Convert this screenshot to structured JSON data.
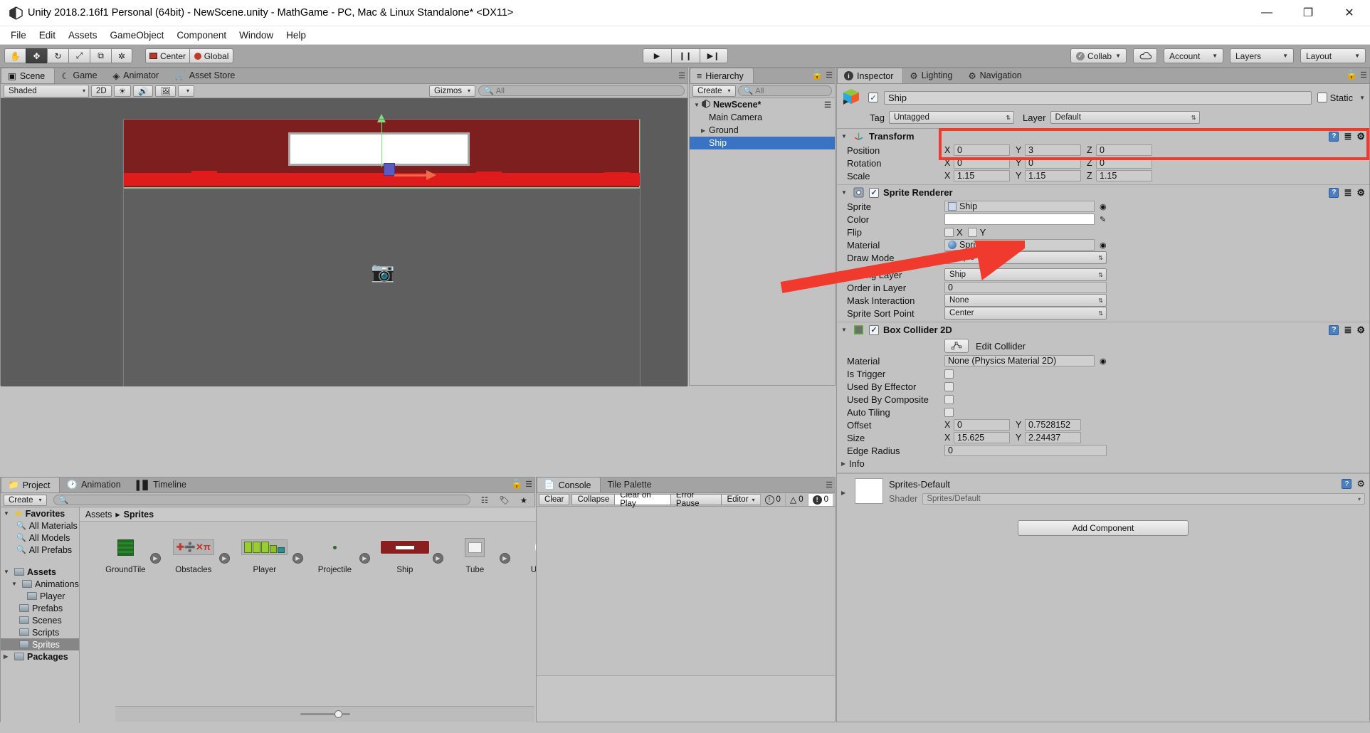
{
  "window": {
    "title": "Unity 2018.2.16f1 Personal (64bit) - NewScene.unity - MathGame - PC, Mac & Linux Standalone* <DX11>",
    "minimize": "—",
    "maximize": "❐",
    "close": "✕"
  },
  "menubar": {
    "items": [
      "File",
      "Edit",
      "Assets",
      "GameObject",
      "Component",
      "Window",
      "Help"
    ]
  },
  "toolbar": {
    "tools": [
      {
        "name": "hand-tool",
        "glyph": "✋"
      },
      {
        "name": "move-tool",
        "glyph": "✥"
      },
      {
        "name": "rotate-tool",
        "glyph": "↻"
      },
      {
        "name": "scale-tool",
        "glyph": "⤢"
      },
      {
        "name": "rect-tool",
        "glyph": "⧉"
      },
      {
        "name": "transform-tool",
        "glyph": "✲"
      }
    ],
    "pivot_label": "Center",
    "space_label": "Global",
    "play": "▶",
    "pause": "❙❙",
    "step": "▶❙",
    "collab": "Collab",
    "cloud": "cloud-icon",
    "account": "Account",
    "layers": "Layers",
    "layout": "Layout"
  },
  "scene": {
    "tabs": [
      {
        "label": "Scene",
        "icon": "grid-icon",
        "active": true
      },
      {
        "label": "Game",
        "icon": "gamepad-icon",
        "active": false
      },
      {
        "label": "Animator",
        "icon": "animator-icon",
        "active": false
      },
      {
        "label": "Asset Store",
        "icon": "store-icon",
        "active": false
      }
    ],
    "draw_mode": "Shaded",
    "mode_2d": "2D",
    "gizmos": "Gizmos",
    "search_placeholder": "All"
  },
  "hierarchy": {
    "tab_label": "Hierarchy",
    "create_label": "Create",
    "search_placeholder": "All",
    "scene_name": "NewScene*",
    "items": [
      {
        "label": "Main Camera",
        "depth": 1,
        "expandable": false,
        "selected": false
      },
      {
        "label": "Ground",
        "depth": 1,
        "expandable": true,
        "selected": false
      },
      {
        "label": "Ship",
        "depth": 1,
        "expandable": false,
        "selected": true
      }
    ]
  },
  "inspector": {
    "tabs": [
      {
        "label": "Inspector",
        "active": true
      },
      {
        "label": "Lighting",
        "active": false
      },
      {
        "label": "Navigation",
        "active": false
      }
    ],
    "object_name": "Ship",
    "enabled": true,
    "static_label": "Static",
    "tag_label": "Tag",
    "tag_value": "Untagged",
    "layer_label": "Layer",
    "layer_value": "Default",
    "transform": {
      "title": "Transform",
      "position": {
        "label": "Position",
        "x": "0",
        "y": "3",
        "z": "0"
      },
      "rotation": {
        "label": "Rotation",
        "x": "0",
        "y": "0",
        "z": "0"
      },
      "scale": {
        "label": "Scale",
        "x": "1.15",
        "y": "1.15",
        "z": "1.15"
      }
    },
    "sprite_renderer": {
      "title": "Sprite Renderer",
      "enabled": true,
      "sprite": {
        "label": "Sprite",
        "value": "Ship"
      },
      "color": {
        "label": "Color",
        "value": "#FFFFFF"
      },
      "flip": {
        "label": "Flip",
        "x_label": "X",
        "y_label": "Y",
        "x": false,
        "y": false
      },
      "material": {
        "label": "Material",
        "value": "Sprites-Default"
      },
      "draw_mode": {
        "label": "Draw Mode",
        "value": "Simple"
      },
      "sorting_layer": {
        "label": "Sorting Layer",
        "value": "Ship"
      },
      "order_in_layer": {
        "label": "Order in Layer",
        "value": "0"
      },
      "mask_interaction": {
        "label": "Mask Interaction",
        "value": "None"
      },
      "sprite_sort_point": {
        "label": "Sprite Sort Point",
        "value": "Center"
      }
    },
    "box_collider": {
      "title": "Box Collider 2D",
      "enabled": true,
      "edit_collider_label": "Edit Collider",
      "material": {
        "label": "Material",
        "value": "None (Physics Material 2D)"
      },
      "is_trigger": {
        "label": "Is Trigger",
        "value": false
      },
      "used_by_effector": {
        "label": "Used By Effector",
        "value": false
      },
      "used_by_composite": {
        "label": "Used By Composite",
        "value": false
      },
      "auto_tiling": {
        "label": "Auto Tiling",
        "value": false
      },
      "offset": {
        "label": "Offset",
        "x": "0",
        "y": "0.7528152"
      },
      "size": {
        "label": "Size",
        "x": "15.625",
        "y": "2.24437"
      },
      "edge_radius": {
        "label": "Edge Radius",
        "value": "0"
      },
      "info_label": "Info"
    },
    "material_block": {
      "name": "Sprites-Default",
      "shader_label": "Shader",
      "shader_value": "Sprites/Default"
    },
    "add_component_label": "Add Component"
  },
  "project": {
    "tabs": [
      {
        "label": "Project",
        "active": true
      },
      {
        "label": "Animation",
        "active": false
      },
      {
        "label": "Timeline",
        "active": false
      }
    ],
    "create_label": "Create",
    "search_placeholder": "",
    "tree": [
      {
        "label": "Favorites",
        "depth": 0,
        "icon": "star-icon",
        "bold": true,
        "expanded": true
      },
      {
        "label": "All Materials",
        "depth": 1,
        "icon": "search-icon",
        "bold": false
      },
      {
        "label": "All Models",
        "depth": 1,
        "icon": "search-icon",
        "bold": false
      },
      {
        "label": "All Prefabs",
        "depth": 1,
        "icon": "search-icon",
        "bold": false
      },
      {
        "label": "",
        "depth": 0,
        "icon": "spacer",
        "bold": false
      },
      {
        "label": "Assets",
        "depth": 0,
        "icon": "folder-icon",
        "bold": true,
        "expanded": true
      },
      {
        "label": "Animations",
        "depth": 1,
        "icon": "folder-icon",
        "bold": false,
        "expanded": true
      },
      {
        "label": "Player",
        "depth": 2,
        "icon": "folder-icon",
        "bold": false
      },
      {
        "label": "Prefabs",
        "depth": 1,
        "icon": "folder-icon",
        "bold": false
      },
      {
        "label": "Scenes",
        "depth": 1,
        "icon": "folder-icon",
        "bold": false
      },
      {
        "label": "Scripts",
        "depth": 1,
        "icon": "folder-icon",
        "bold": false
      },
      {
        "label": "Sprites",
        "depth": 1,
        "icon": "folder-icon",
        "bold": false,
        "selected": true
      },
      {
        "label": "Packages",
        "depth": 0,
        "icon": "folder-icon",
        "bold": true,
        "expanded": false
      }
    ],
    "breadcrumb": {
      "root": "Assets",
      "sep": "▸",
      "current": "Sprites"
    },
    "assets": [
      {
        "name": "GroundTile",
        "kind": "ground-tile"
      },
      {
        "name": "Obstacles",
        "kind": "obstacles-sheet"
      },
      {
        "name": "Player",
        "kind": "player-sheet"
      },
      {
        "name": "Projectile",
        "kind": "projectile-dot"
      },
      {
        "name": "Ship",
        "kind": "ship-sprite"
      },
      {
        "name": "Tube",
        "kind": "tube-sprite"
      },
      {
        "name": "UIDial",
        "kind": "uidial-sprite"
      }
    ]
  },
  "console": {
    "tabs": [
      {
        "label": "Console",
        "active": true
      },
      {
        "label": "Tile Palette",
        "active": false
      }
    ],
    "buttons": [
      {
        "label": "Clear",
        "on": false
      },
      {
        "label": "Collapse",
        "on": false
      },
      {
        "label": "Clear on Play",
        "on": true
      },
      {
        "label": "Error Pause",
        "on": false
      },
      {
        "label": "Editor",
        "on": false,
        "dropdown": true
      }
    ],
    "counters": [
      {
        "icon": "info-icon",
        "count": "0",
        "highlight": false
      },
      {
        "icon": "warning-icon",
        "count": "0",
        "highlight": false
      },
      {
        "icon": "error-icon",
        "count": "0",
        "highlight": true
      }
    ]
  },
  "annotations": {
    "accent_color": "#F03A2E",
    "rect_target": "transform-rotation-scale-rows",
    "arrow_target": "sorting-layer-dropdown"
  }
}
